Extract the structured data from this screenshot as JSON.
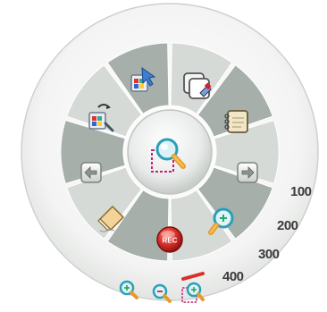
{
  "radial_menu": {
    "ring_items": [
      {
        "name": "arrange-icon-button",
        "icon": "arrange-icon",
        "interactable": true
      },
      {
        "name": "cursor-icon-button",
        "icon": "cursor-icon",
        "interactable": true
      },
      {
        "name": "page-icon-button",
        "icon": "page-icon",
        "interactable": true
      },
      {
        "name": "notepad-icon-button",
        "icon": "notepad-icon",
        "interactable": true
      },
      {
        "name": "next-arrow-button",
        "icon": "arrow-right-icon",
        "interactable": true
      },
      {
        "name": "zoom-in-button",
        "icon": "zoom-in-icon",
        "interactable": true
      },
      {
        "name": "record-button",
        "icon": "rec-icon",
        "interactable": true
      },
      {
        "name": "eraser-button",
        "icon": "eraser-icon",
        "interactable": true
      },
      {
        "name": "previous-arrow-button",
        "icon": "arrow-left-icon",
        "interactable": true
      }
    ],
    "center_tool": {
      "icon": "magnifier-selection-icon"
    },
    "record_label": "REC"
  },
  "zoom_levels": {
    "labels": [
      "100",
      "200",
      "300",
      "400"
    ],
    "active_index": 3
  },
  "bottom_tools": [
    {
      "name": "zoom-in-small-icon"
    },
    {
      "name": "zoom-out-small-icon"
    },
    {
      "name": "zoom-area-small-icon"
    }
  ],
  "colors": {
    "segment_dark": "#a7afaa",
    "segment_light": "#d6dad7",
    "ring_bg": "#f4f5f4",
    "accent_red": "#d9302c",
    "magenta_selection": "#c4207a",
    "magnifier_teal": "#2aa0b8"
  }
}
